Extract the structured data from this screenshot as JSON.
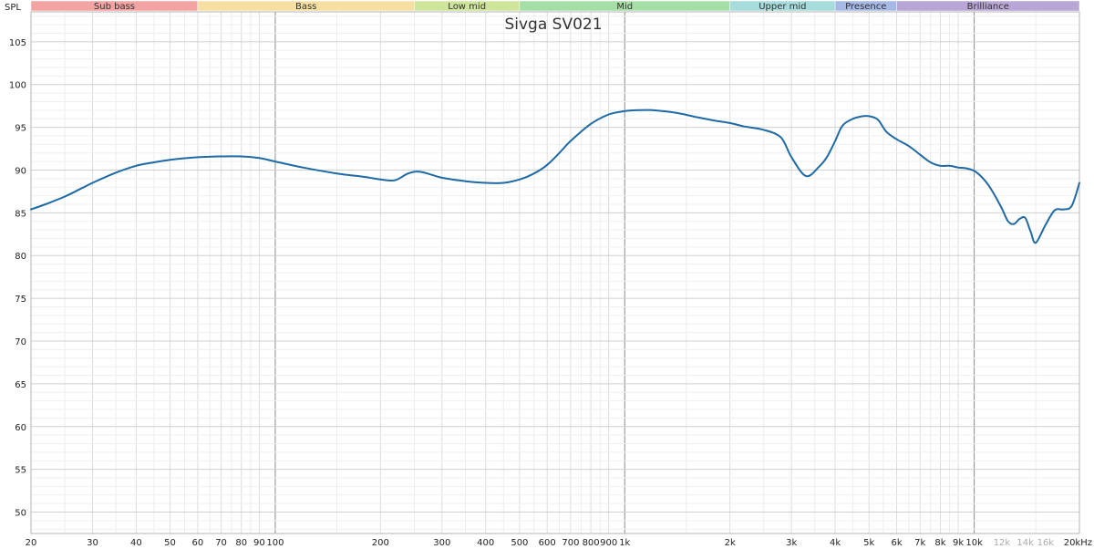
{
  "chart_data": {
    "type": "line",
    "title": "Sivga SV021",
    "ylabel": "SPL",
    "xscale": "log",
    "xlim": [
      20,
      20000
    ],
    "ylim": [
      47.5,
      108.5
    ],
    "grid": true,
    "yticks": [
      50,
      55,
      60,
      65,
      70,
      75,
      80,
      85,
      90,
      95,
      100,
      105
    ],
    "xticks": [
      {
        "value": 20,
        "label": "20"
      },
      {
        "value": 30,
        "label": "30"
      },
      {
        "value": 40,
        "label": "40"
      },
      {
        "value": 50,
        "label": "50"
      },
      {
        "value": 60,
        "label": "60"
      },
      {
        "value": 70,
        "label": "70"
      },
      {
        "value": 80,
        "label": "80"
      },
      {
        "value": 90,
        "label": "90"
      },
      {
        "value": 100,
        "label": "100"
      },
      {
        "value": 200,
        "label": "200"
      },
      {
        "value": 300,
        "label": "300"
      },
      {
        "value": 400,
        "label": "400"
      },
      {
        "value": 500,
        "label": "500"
      },
      {
        "value": 600,
        "label": "600"
      },
      {
        "value": 700,
        "label": "700"
      },
      {
        "value": 800,
        "label": "800"
      },
      {
        "value": 900,
        "label": "900"
      },
      {
        "value": 1000,
        "label": "1k"
      },
      {
        "value": 2000,
        "label": "2k"
      },
      {
        "value": 3000,
        "label": "3k"
      },
      {
        "value": 4000,
        "label": "4k"
      },
      {
        "value": 5000,
        "label": "5k"
      },
      {
        "value": 6000,
        "label": "6k"
      },
      {
        "value": 7000,
        "label": "7k"
      },
      {
        "value": 8000,
        "label": "8k"
      },
      {
        "value": 9000,
        "label": "9k"
      },
      {
        "value": 10000,
        "label": "10k"
      },
      {
        "value": 12000,
        "label": "12k",
        "muted": true
      },
      {
        "value": 14000,
        "label": "14k",
        "muted": true
      },
      {
        "value": 16000,
        "label": "16k",
        "muted": true
      },
      {
        "value": 20000,
        "label": "20kHz"
      }
    ],
    "bands": [
      {
        "label": "Sub bass",
        "from": 20,
        "to": 60,
        "color": "#f4a3a3"
      },
      {
        "label": "Bass",
        "from": 60,
        "to": 250,
        "color": "#f6dfa0"
      },
      {
        "label": "Low mid",
        "from": 250,
        "to": 500,
        "color": "#cfe59a"
      },
      {
        "label": "Mid",
        "from": 500,
        "to": 2000,
        "color": "#a6dfa6"
      },
      {
        "label": "Upper mid",
        "from": 2000,
        "to": 4000,
        "color": "#a6dcdc"
      },
      {
        "label": "Presence",
        "from": 4000,
        "to": 6000,
        "color": "#a5b8e6"
      },
      {
        "label": "Brilliance",
        "from": 6000,
        "to": 20000,
        "color": "#b9a6d6"
      }
    ],
    "series": [
      {
        "color": "#1f6aa5",
        "x": [
          20,
          22,
          25,
          28,
          30,
          35,
          40,
          45,
          50,
          60,
          70,
          80,
          90,
          100,
          120,
          150,
          180,
          200,
          220,
          240,
          260,
          300,
          350,
          400,
          450,
          500,
          550,
          600,
          650,
          700,
          800,
          900,
          1000,
          1100,
          1200,
          1400,
          1600,
          1800,
          2000,
          2200,
          2500,
          2800,
          3000,
          3300,
          3600,
          3800,
          4000,
          4200,
          4500,
          4800,
          5000,
          5300,
          5600,
          6000,
          6500,
          7000,
          7500,
          8000,
          8500,
          9000,
          9500,
          10000,
          10500,
          11000,
          11500,
          12000,
          12500,
          13000,
          13500,
          14000,
          14500,
          15000,
          16000,
          17000,
          18000,
          19000,
          20000
        ],
        "y": [
          85.4,
          86.0,
          86.9,
          87.9,
          88.5,
          89.7,
          90.5,
          90.9,
          91.2,
          91.5,
          91.6,
          91.6,
          91.4,
          91.0,
          90.3,
          89.6,
          89.2,
          88.9,
          88.8,
          89.6,
          89.8,
          89.1,
          88.7,
          88.5,
          88.5,
          88.9,
          89.6,
          90.6,
          92.0,
          93.4,
          95.4,
          96.5,
          96.9,
          97.0,
          97.0,
          96.7,
          96.2,
          95.8,
          95.5,
          95.1,
          94.7,
          93.8,
          91.5,
          89.3,
          90.4,
          91.6,
          93.4,
          95.2,
          96.0,
          96.3,
          96.3,
          95.9,
          94.5,
          93.6,
          92.8,
          91.8,
          90.9,
          90.5,
          90.5,
          90.3,
          90.2,
          89.9,
          89.2,
          88.2,
          86.9,
          85.5,
          84.0,
          83.7,
          84.3,
          84.4,
          82.8,
          81.5,
          83.6,
          85.3,
          85.4,
          85.8,
          88.5
        ]
      }
    ]
  }
}
